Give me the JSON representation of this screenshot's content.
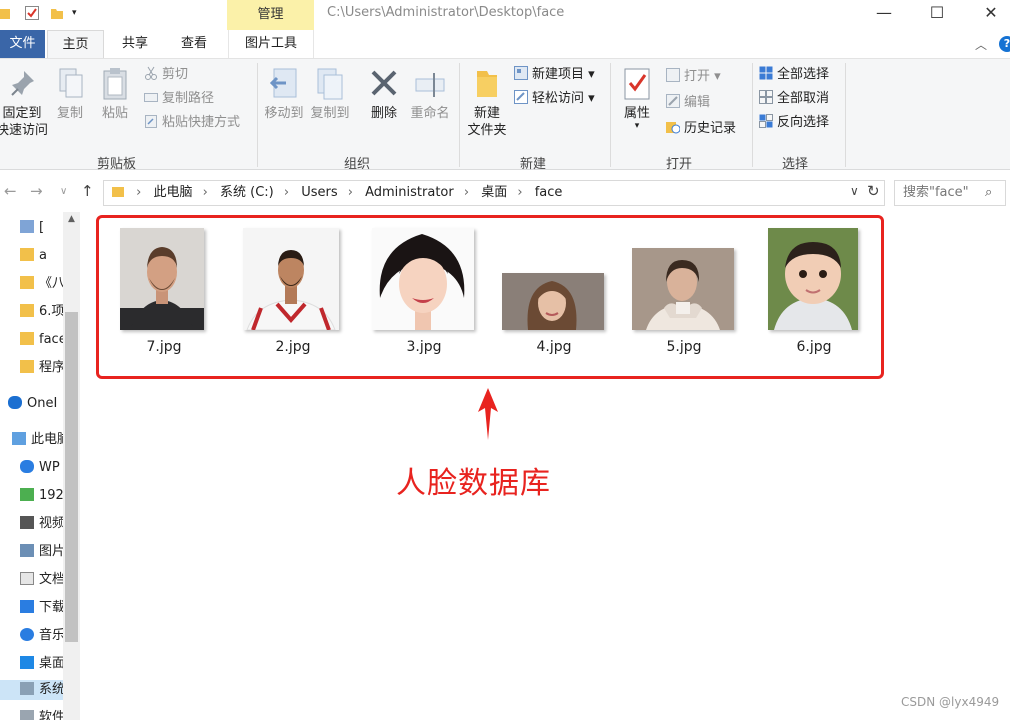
{
  "window": {
    "manage_tab": "管理",
    "title_path": "C:\\Users\\Administrator\\Desktop\\face",
    "minimize": "—",
    "maximize": "☐",
    "close": "✕"
  },
  "tabs": {
    "file": "文件",
    "home": "主页",
    "share": "共享",
    "view": "查看",
    "picture_tools": "图片工具"
  },
  "ribbon": {
    "clipboard": {
      "label": "剪贴板",
      "pin_line1": "固定到",
      "pin_line2": "快速访问",
      "copy": "复制",
      "paste": "粘贴",
      "cut": "剪切",
      "copy_path": "复制路径",
      "paste_shortcut": "粘贴快捷方式"
    },
    "organize": {
      "label": "组织",
      "move_to": "移动到",
      "copy_to": "复制到",
      "delete": "删除",
      "rename": "重命名"
    },
    "new": {
      "label": "新建",
      "new_folder_line1": "新建",
      "new_folder_line2": "文件夹",
      "new_item": "新建项目",
      "easy_access": "轻松访问"
    },
    "open": {
      "label": "打开",
      "properties": "属性",
      "open": "打开",
      "edit": "编辑",
      "history": "历史记录"
    },
    "select": {
      "label": "选择",
      "select_all": "全部选择",
      "select_none": "全部取消",
      "invert": "反向选择"
    }
  },
  "address": {
    "crumbs": [
      "此电脑",
      "系统 (C:)",
      "Users",
      "Administrator",
      "桌面",
      "face"
    ],
    "search_placeholder": "搜索\"face\""
  },
  "sidebar": {
    "items": [
      {
        "label": "[",
        "icon": "picture-folder-icon"
      },
      {
        "label": "a",
        "icon": "folder-icon"
      },
      {
        "label": "《八",
        "icon": "folder-icon"
      },
      {
        "label": "6.项",
        "icon": "folder-icon"
      },
      {
        "label": "face",
        "icon": "folder-icon"
      },
      {
        "label": "程序",
        "icon": "folder-icon"
      },
      {
        "label": "OneI",
        "icon": "onedrive-icon"
      },
      {
        "label": "此电脑",
        "icon": "pc-icon"
      },
      {
        "label": "WP",
        "icon": "cloud-icon"
      },
      {
        "label": "192",
        "icon": "network-drive-icon"
      },
      {
        "label": "视频",
        "icon": "video-icon"
      },
      {
        "label": "图片",
        "icon": "picture-icon"
      },
      {
        "label": "文档",
        "icon": "document-icon"
      },
      {
        "label": "下载",
        "icon": "download-icon"
      },
      {
        "label": "音乐",
        "icon": "music-icon"
      },
      {
        "label": "桌面",
        "icon": "desktop-icon"
      },
      {
        "label": "系统",
        "icon": "system-drive-icon"
      },
      {
        "label": "软件",
        "icon": "drive-icon"
      }
    ]
  },
  "files": [
    {
      "name": "7.jpg"
    },
    {
      "name": "2.jpg"
    },
    {
      "name": "3.jpg"
    },
    {
      "name": "4.jpg"
    },
    {
      "name": "5.jpg"
    },
    {
      "name": "6.jpg"
    }
  ],
  "annotation": {
    "text": "人脸数据库",
    "color": "#e8231f"
  },
  "watermark": "CSDN @lyx4949"
}
